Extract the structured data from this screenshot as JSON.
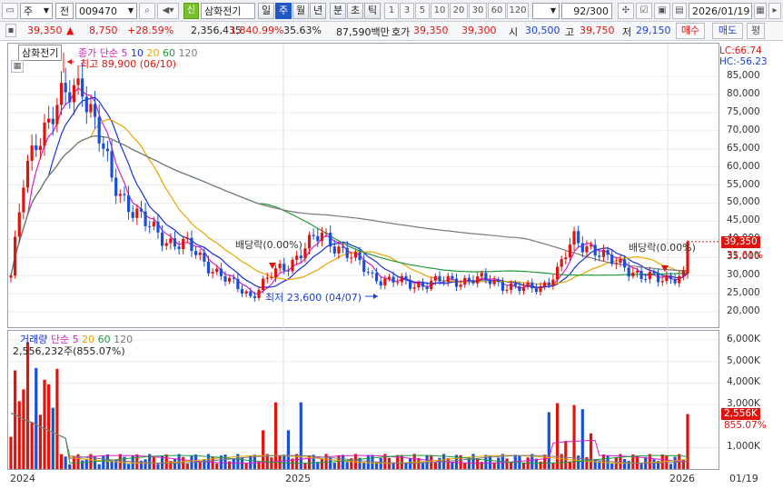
{
  "toolbar": {
    "period_mode": "주",
    "market_select": "전",
    "stock_code": "009470",
    "stock_badge": "신",
    "stock_name": "삼화전기",
    "period_tabs": [
      "일",
      "주",
      "월",
      "년",
      "분",
      "초",
      "틱"
    ],
    "active_period": "주",
    "presets": [
      "1",
      "3",
      "5",
      "10",
      "20",
      "30",
      "60",
      "120"
    ],
    "count_label": "92/300",
    "date_value": "2026/01/19"
  },
  "quote": {
    "price": "39,350",
    "change_arrow": "▲",
    "change": "8,750",
    "change_rate": "+28.59%",
    "volume": "2,356,435",
    "volume_rate": "1,840.99%",
    "turnover_rate": "35.63%",
    "amount": "87,590백만",
    "bid_label": "호가",
    "ask_price": "39,350",
    "bid_price": "39,300",
    "open_label": "시",
    "open": "30,500",
    "high_label": "고",
    "high": "39,750",
    "low_label": "저",
    "low": "29,150",
    "buy_label": "매수",
    "sell_label": "매도",
    "eval_label": "평"
  },
  "price_panel": {
    "stock_tag": "삼화전기",
    "legend_prefix": "종가 단순",
    "ma_periods": [
      "5",
      "10",
      "20",
      "60",
      "120"
    ],
    "ma_colors": [
      "#d61fc8",
      "#1a2ed6",
      "#e8a400",
      "#1e9b3c",
      "#7a7a7a"
    ],
    "lc_label": "LC:66.74",
    "hc_label": "HC:-56.23",
    "high_annotation": "최고 89,900 (06/10)",
    "low_annotation": "최저 23,600 (04/07)",
    "dividend_label_1": "배당락(0.00%)",
    "dividend_label_2": "배당락(0.00%)",
    "last_price_tag": "39,350",
    "last_pct_tag": "31.61%",
    "y_ticks": [
      "85,000",
      "80,000",
      "75,000",
      "70,000",
      "65,000",
      "60,000",
      "55,000",
      "50,000",
      "45,000",
      "40,000",
      "35,000",
      "30,000",
      "25,000",
      "20,000"
    ]
  },
  "volume_panel": {
    "title": "거래량",
    "legend_prefix": "단순",
    "ma_periods": [
      "5",
      "20",
      "60",
      "120"
    ],
    "ma_colors": [
      "#d61fc8",
      "#e8a400",
      "#1e9b3c",
      "#7a7a7a"
    ],
    "max_label": "2,556,232주(855.07%)",
    "last_volume_tag": "2,556K",
    "last_pct_tag": "855.07%",
    "y_ticks": [
      "6,000K",
      "5,000K",
      "4,000K",
      "3,000K",
      "1,000K"
    ]
  },
  "x_axis": {
    "labels": [
      "2024",
      "2025",
      "2026"
    ],
    "cursor_date": "01/19"
  },
  "colors": {
    "up": "#e0140f",
    "down": "#1a4fd6",
    "accent": "#1f57c3"
  },
  "chart_data": {
    "type": "candlestick",
    "x_start": "2024-01",
    "x_end": "2026-01-19",
    "interval": "week",
    "price_ylim": [
      18000,
      88000
    ],
    "volume_ylim": [
      0,
      6200000
    ],
    "last": {
      "open": 30500,
      "high": 39750,
      "low": 29150,
      "close": 39350,
      "volume": 2556232
    }
  }
}
